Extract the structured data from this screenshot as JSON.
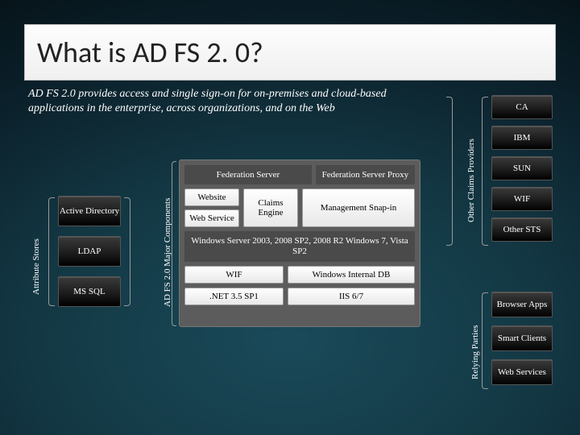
{
  "title": "What is AD FS 2. 0?",
  "description": "AD FS 2.0 provides access and single sign-on for on-premises and cloud-based applications in the enterprise, across organizations, and on the Web",
  "attribute_stores": {
    "label": "Attribute Stores",
    "items": [
      "Active Directory",
      "LDAP",
      "MS SQL"
    ]
  },
  "major_components": {
    "label": "AD FS 2.0 Major Components",
    "fed_server": "Federation Server",
    "fed_server_proxy": "Federation Server Proxy",
    "website": "Website",
    "web_service": "Web Service",
    "claims_engine": "Claims Engine",
    "mgmt_snapin": "Management Snap-in",
    "windows_server": "Windows Server 2003, 2008 SP2, 2008 R2 Windows 7, Vista SP2",
    "wif": "WIF",
    "win_internal_db": "Windows Internal DB",
    "net35sp1": ".NET 3.5 SP1",
    "iis": "IIS 6/7"
  },
  "other_claims_providers": {
    "label": "Other Claims Providers",
    "items": [
      "CA",
      "IBM",
      "SUN",
      "WIF",
      "Other STS"
    ]
  },
  "relying_parties": {
    "label": "Relying Parties",
    "items": [
      "Browser Apps",
      "Smart Clients",
      "Web Services"
    ]
  }
}
